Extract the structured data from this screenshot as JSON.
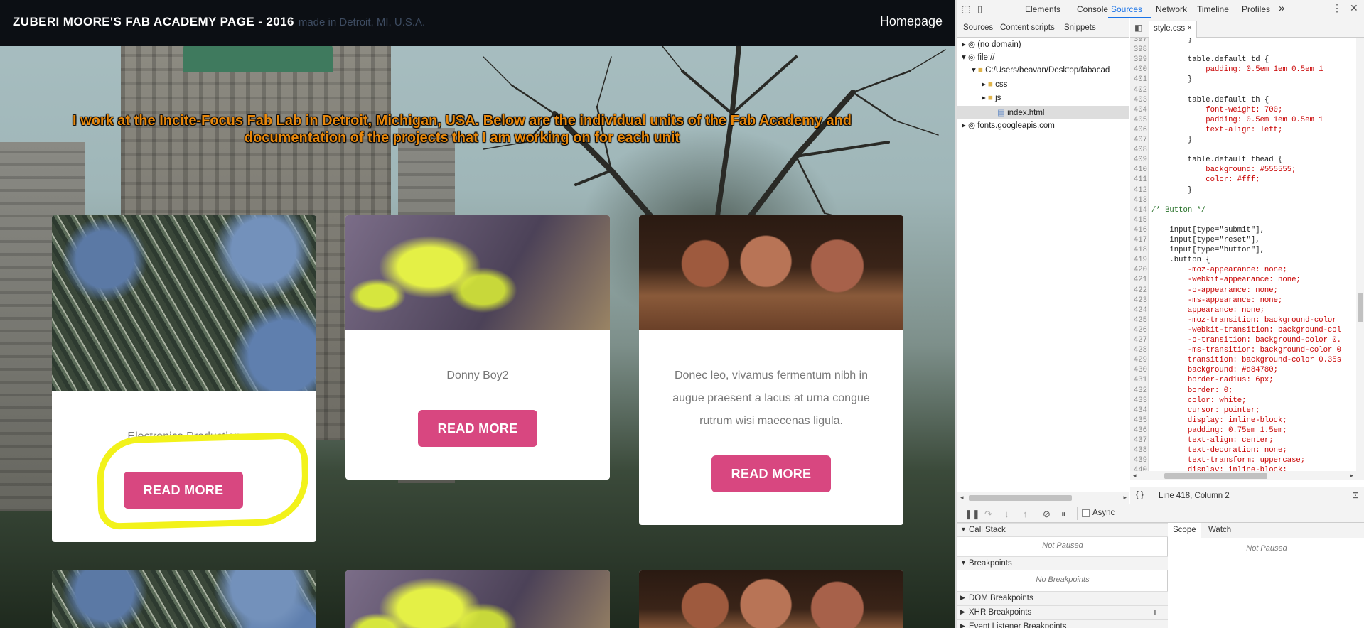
{
  "page": {
    "title": "ZUBERI MOORE'S FAB ACADEMY PAGE - 2016",
    "subtitle": "made in Detroit, MI, U.S.A.",
    "nav_link": "Homepage",
    "intro": "I work at the Incite-Focus Fab Lab in Detroit, Michigan, USA. Below are the individual units of the Fab Academy and documentation of the projects that I am working on for each unit",
    "cards": [
      {
        "text": "Electronics Production",
        "button": "READ MORE",
        "image": "electronics-photo"
      },
      {
        "text": "Donny Boy2",
        "button": "READ MORE",
        "image": "plant-photo"
      },
      {
        "text": "Donec leo, vivamus fermentum nibh in augue praesent a lacus at urna congue rutrum wisi maecenas ligula.",
        "button": "READ MORE",
        "image": "nuts-photo"
      }
    ],
    "accent_color": "#d84780",
    "highlight_color": "#f2f21a"
  },
  "devtools": {
    "tabs": [
      "Elements",
      "Console",
      "Sources",
      "Network",
      "Timeline",
      "Profiles"
    ],
    "more": "»",
    "active_tab": "Sources",
    "nav_tabs": [
      "Sources",
      "Content scripts",
      "Snippets"
    ],
    "tree": {
      "no_domain": "(no domain)",
      "file": "file://",
      "path": "C:/Users/beavan/Desktop/fabacad",
      "css": "css",
      "js": "js",
      "index": "index.html",
      "fonts": "fonts.googleapis.com"
    },
    "open_file": "style.css",
    "close": "×",
    "code_lines": [
      {
        "n": "397",
        "t": "        }"
      },
      {
        "n": "398",
        "t": ""
      },
      {
        "n": "399",
        "t": "        table.default td {"
      },
      {
        "n": "400",
        "t": "            padding: 0.5em 1em 0.5em 1"
      },
      {
        "n": "401",
        "t": "        }"
      },
      {
        "n": "402",
        "t": ""
      },
      {
        "n": "403",
        "t": "        table.default th {"
      },
      {
        "n": "404",
        "t": "            font-weight: 700;"
      },
      {
        "n": "405",
        "t": "            padding: 0.5em 1em 0.5em 1"
      },
      {
        "n": "406",
        "t": "            text-align: left;"
      },
      {
        "n": "407",
        "t": "        }"
      },
      {
        "n": "408",
        "t": ""
      },
      {
        "n": "409",
        "t": "        table.default thead {"
      },
      {
        "n": "410",
        "t": "            background: #555555;"
      },
      {
        "n": "411",
        "t": "            color: #fff;"
      },
      {
        "n": "412",
        "t": "        }"
      },
      {
        "n": "413",
        "t": ""
      },
      {
        "n": "414",
        "t": "/* Button */"
      },
      {
        "n": "415",
        "t": ""
      },
      {
        "n": "416",
        "t": "    input[type=\"submit\"],"
      },
      {
        "n": "417",
        "t": "    input[type=\"reset\"],"
      },
      {
        "n": "418",
        "t": "    input[type=\"button\"],"
      },
      {
        "n": "419",
        "t": "    .button {"
      },
      {
        "n": "420",
        "t": "        -moz-appearance: none;"
      },
      {
        "n": "421",
        "t": "        -webkit-appearance: none;"
      },
      {
        "n": "422",
        "t": "        -o-appearance: none;"
      },
      {
        "n": "423",
        "t": "        -ms-appearance: none;"
      },
      {
        "n": "424",
        "t": "        appearance: none;"
      },
      {
        "n": "425",
        "t": "        -moz-transition: background-color"
      },
      {
        "n": "426",
        "t": "        -webkit-transition: background-col"
      },
      {
        "n": "427",
        "t": "        -o-transition: background-color 0."
      },
      {
        "n": "428",
        "t": "        -ms-transition: background-color 0"
      },
      {
        "n": "429",
        "t": "        transition: background-color 0.35s"
      },
      {
        "n": "430",
        "t": "        background: #d84780;"
      },
      {
        "n": "431",
        "t": "        border-radius: 6px;"
      },
      {
        "n": "432",
        "t": "        border: 0;"
      },
      {
        "n": "433",
        "t": "        color: white;"
      },
      {
        "n": "434",
        "t": "        cursor: pointer;"
      },
      {
        "n": "435",
        "t": "        display: inline-block;"
      },
      {
        "n": "436",
        "t": "        padding: 0.75em 1.5em;"
      },
      {
        "n": "437",
        "t": "        text-align: center;"
      },
      {
        "n": "438",
        "t": "        text-decoration: none;"
      },
      {
        "n": "439",
        "t": "        text-transform: uppercase;"
      },
      {
        "n": "440",
        "t": "        display: inline-block;"
      }
    ],
    "status": "Line 418, Column 2",
    "async": "Async",
    "sections": [
      "Call Stack",
      "Breakpoints",
      "DOM Breakpoints",
      "XHR Breakpoints",
      "Event Listener Breakpoints"
    ],
    "not_paused": "Not Paused",
    "no_breakpoints": "No Breakpoints",
    "scope_tab": "Scope",
    "watch_tab": "Watch"
  }
}
